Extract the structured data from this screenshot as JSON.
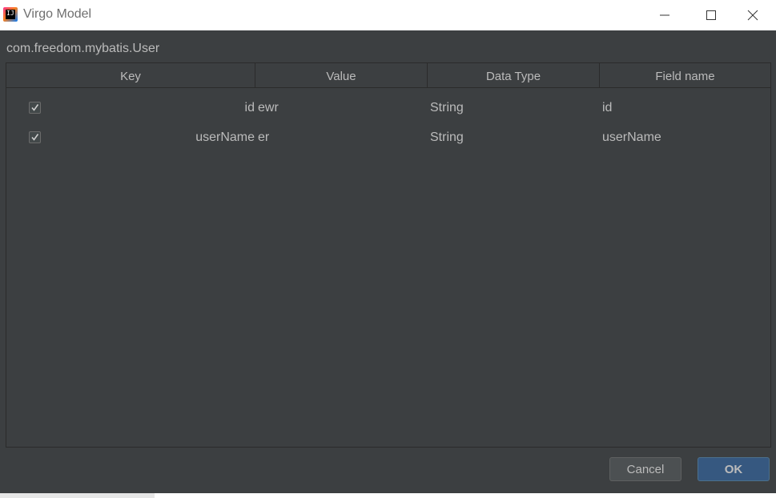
{
  "window": {
    "title": "Virgo Model",
    "icon": "intellij-idea-icon",
    "controls": [
      "minimize-icon",
      "maximize-icon",
      "close-icon"
    ]
  },
  "dialog": {
    "class_name": "com.freedom.mybatis.User",
    "table": {
      "columns": [
        "Key",
        "Value",
        "Data Type",
        "Field name"
      ],
      "rows": [
        {
          "checked": true,
          "key": "id",
          "value": "ewr",
          "data_type": "String",
          "field_name": "id"
        },
        {
          "checked": true,
          "key": "userName",
          "value": "er",
          "data_type": "String",
          "field_name": "userName"
        }
      ]
    },
    "buttons": {
      "cancel": "Cancel",
      "ok": "OK"
    }
  },
  "colors": {
    "dialog_background": "#3c3f41",
    "text": "#bbbbbb",
    "ok_button": "#365880",
    "cancel_button": "#4c5052"
  }
}
